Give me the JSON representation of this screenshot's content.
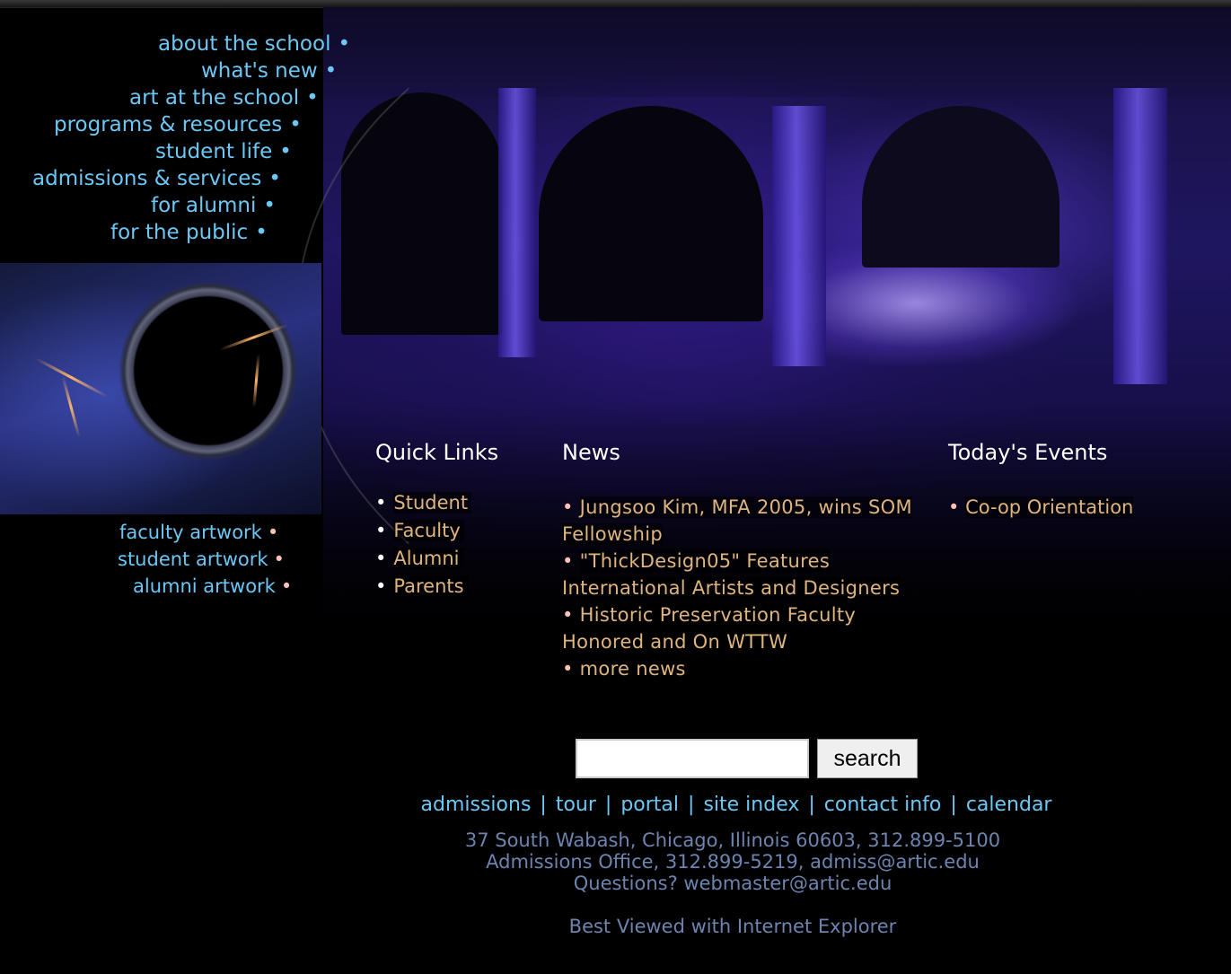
{
  "nav": {
    "items": [
      {
        "label": "about the school"
      },
      {
        "label": "what's new"
      },
      {
        "label": "art at the school"
      },
      {
        "label": "programs & resources"
      },
      {
        "label": "student life"
      },
      {
        "label": "admissions & services"
      },
      {
        "label": "for alumni"
      },
      {
        "label": "for the public"
      }
    ],
    "bullet": "•"
  },
  "artwork_links": {
    "items": [
      {
        "label": "faculty artwork"
      },
      {
        "label": "student artwork"
      },
      {
        "label": "alumni artwork"
      }
    ],
    "bullet": "•"
  },
  "quick_links": {
    "heading": "Quick Links",
    "bullet": "•",
    "items": [
      {
        "label": "Student"
      },
      {
        "label": "Faculty"
      },
      {
        "label": "Alumni"
      },
      {
        "label": "Parents"
      }
    ]
  },
  "news": {
    "heading": "News",
    "bullet": "•",
    "items": [
      {
        "label": "Jungsoo Kim, MFA 2005, wins SOM Fellowship"
      },
      {
        "label": "\"ThickDesign05\" Features International Artists and Designers"
      },
      {
        "label": "Historic Preservation Faculty Honored and On WTTW"
      },
      {
        "label": "more news"
      }
    ]
  },
  "events": {
    "heading": "Today's Events",
    "bullet": "•",
    "items": [
      {
        "label": "Co-op Orientation"
      }
    ]
  },
  "search": {
    "value": "",
    "button_label": "search"
  },
  "footer": {
    "separator": "|",
    "links": [
      {
        "label": "admissions"
      },
      {
        "label": "tour"
      },
      {
        "label": "portal"
      },
      {
        "label": "site index"
      },
      {
        "label": "contact info"
      },
      {
        "label": "calendar"
      }
    ],
    "address_lines": [
      "37 South Wabash, Chicago, Illinois 60603, 312.899-5100",
      "Admissions Office, 312.899-5219, admiss@artic.edu",
      "Questions? webmaster@artic.edu"
    ],
    "best_viewed": "Best Viewed with Internet Explorer"
  },
  "colors": {
    "background": "#000000",
    "nav_link": "#6cc7f5",
    "content_link": "#e0b47e",
    "footer_text": "#6d84b0",
    "heading": "#ffffff"
  }
}
